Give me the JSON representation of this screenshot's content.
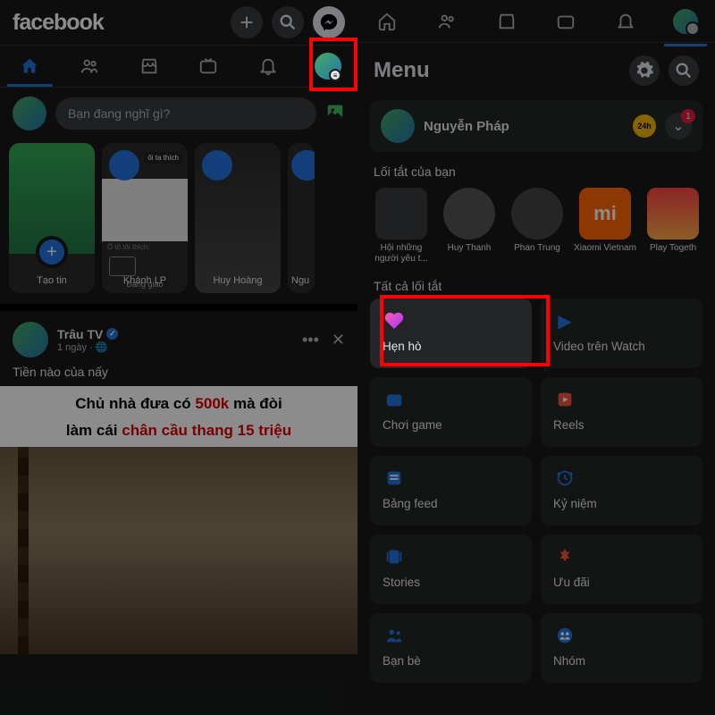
{
  "left": {
    "logo": "facebook",
    "compose_placeholder": "Bạn đang nghĩ gì?",
    "stories": [
      {
        "label": "Tạo tin"
      },
      {
        "label": "Khánh LP",
        "tag1": "ôi ta thích",
        "tag2": "Ô tô tôi thích:",
        "tag3": "Đang giao"
      },
      {
        "label": "Huy Hoàng"
      },
      {
        "label": "Ngu"
      }
    ],
    "post": {
      "author": "Trâu TV",
      "time": "1 ngày",
      "text": "Tiền nào của nấy",
      "img_line1a": "Chủ nhà đưa có ",
      "img_line1b": "500k",
      "img_line1c": " mà đòi",
      "img_line2a": "làm cái ",
      "img_line2b": "chân cầu thang 15 triệu"
    }
  },
  "right": {
    "title": "Menu",
    "user": "Nguyễn Pháp",
    "badge_count": "1",
    "sec_shortcuts": "Lối tắt của bạn",
    "shortcuts": [
      {
        "label": "Hội những người yêu t..."
      },
      {
        "label": "Huy Thanh"
      },
      {
        "label": "Phan Trung"
      },
      {
        "label": "Xiaomi Vietnam",
        "xi": "mi"
      },
      {
        "label": "Play Togeth"
      }
    ],
    "sec_all": "Tất cả lối tắt",
    "cards": [
      {
        "label": "Hẹn hò",
        "icon": "heart"
      },
      {
        "label": "Video trên Watch",
        "icon": "watch"
      },
      {
        "label": "Chơi game",
        "icon": "game"
      },
      {
        "label": "Reels",
        "icon": "reels"
      },
      {
        "label": "Bảng feed",
        "icon": "feed"
      },
      {
        "label": "Kỷ niệm",
        "icon": "clock"
      },
      {
        "label": "Stories",
        "icon": "stories"
      },
      {
        "label": "Ưu đãi",
        "icon": "deal"
      },
      {
        "label": "Bạn bè",
        "icon": "friends"
      },
      {
        "label": "Nhóm",
        "icon": "groups"
      }
    ]
  }
}
